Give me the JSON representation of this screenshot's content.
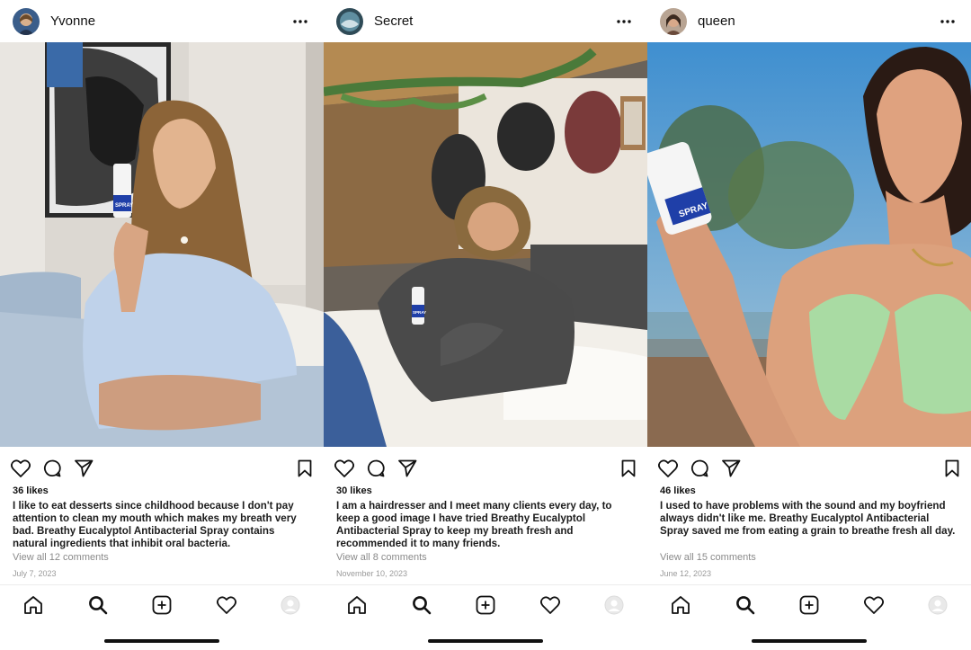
{
  "posts": [
    {
      "username": "Yvonne",
      "likes": "36 likes",
      "caption": "I like to eat desserts since childhood because I don't pay attention to clean my mouth which makes my breath very bad. Breathy Eucalyptol Antibacterial Spray contains natural ingredients that inhibit oral bacteria.",
      "comments": "View all 12 comments",
      "date": "July 7, 2023",
      "spray_label": "SPRAY"
    },
    {
      "username": "Secret",
      "likes": "30 likes",
      "caption": "I am a hairdresser and I meet many clients every day, to keep a good image I have tried Breathy Eucalyptol Antibacterial Spray to keep my breath fresh and recommended it to many friends.",
      "comments": "View all 8 comments",
      "date": "November 10, 2023",
      "spray_label": "SPRAY"
    },
    {
      "username": "queen",
      "likes": "46 likes",
      "caption": "I used to have problems with the sound and my boyfriend always didn't like me. Breathy Eucalyptol Antibacterial Spray saved me from eating a grain to breathe fresh all day.",
      "comments": "View all 15 comments",
      "date": "June 12, 2023",
      "spray_label": "SPRAY"
    }
  ],
  "icons": {
    "post_actions": [
      "heart-icon",
      "comment-icon",
      "share-icon",
      "bookmark-icon"
    ],
    "header": "more-icon",
    "tabbar": [
      "home-icon",
      "search-icon",
      "add-icon",
      "heart-icon",
      "profile-icon"
    ]
  },
  "colors": {
    "spray_blue": "#1f3fa8",
    "text": "#111111",
    "muted": "#8a8a8a"
  }
}
